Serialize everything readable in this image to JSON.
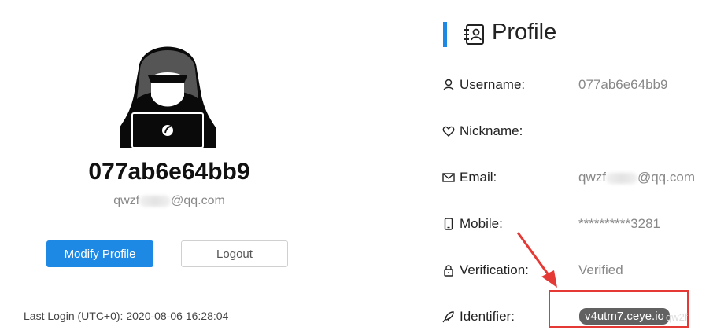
{
  "user": {
    "display_username": "077ab6e64bb9",
    "email_prefix": "qwzf",
    "email_suffix": "@qq.com"
  },
  "actions": {
    "modify_label": "Modify Profile",
    "logout_label": "Logout"
  },
  "last_login": "Last Login (UTC+0): 2020-08-06 16:28:04",
  "profile": {
    "title": "Profile",
    "fields": [
      {
        "label": "Username:",
        "value": "077ab6e64bb9",
        "icon": "user-icon"
      },
      {
        "label": "Nickname:",
        "value": "",
        "icon": "heart-icon"
      },
      {
        "label": "Email:",
        "value_prefix": "qwzf",
        "value_suffix": "@qq.com",
        "icon": "mail-icon"
      },
      {
        "label": "Mobile:",
        "value": "**********3281",
        "icon": "mobile-icon"
      },
      {
        "label": "Verification:",
        "value": "Verified",
        "icon": "lock-icon"
      },
      {
        "label": "Identifier:",
        "value": "v4utm7.ceye.io",
        "icon": "rocket-icon"
      }
    ]
  },
  "ghost_text": "qw2f",
  "colors": {
    "accent": "#1e88e5",
    "annotation": "#e53935",
    "muted": "#888888"
  }
}
